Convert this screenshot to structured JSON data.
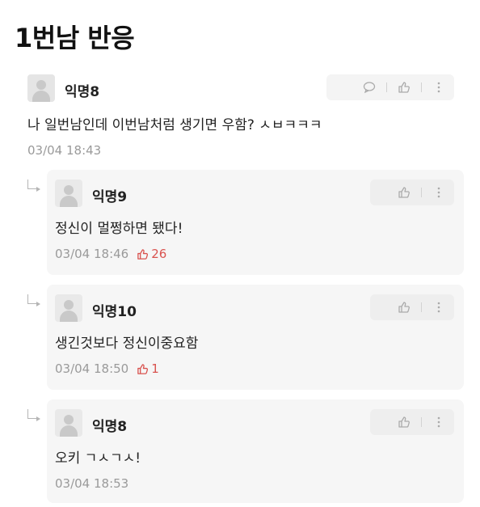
{
  "page": {
    "title": "1번남 반응"
  },
  "icons": {
    "comment": "comment-bubble-icon",
    "like": "thumbs-up-icon",
    "more": "more-vertical-icon",
    "reply": "reply-arrow-icon",
    "avatar": "default-avatar-icon"
  },
  "colors": {
    "like_red": "#d9534f",
    "meta_gray": "#9a9a9a",
    "card_bg": "#f6f6f6"
  },
  "top_comment": {
    "author": "익명8",
    "text": "나 일번남인데 이번남처럼 생기면 우함? ㅅㅂㅋㅋㅋ",
    "timestamp": "03/04 18:43"
  },
  "replies": [
    {
      "author": "익명9",
      "text": "정신이 멀쩡하면 됐다!",
      "timestamp": "03/04 18:46",
      "likes": "26"
    },
    {
      "author": "익명10",
      "text": "생긴것보다 정신이중요함",
      "timestamp": "03/04 18:50",
      "likes": "1"
    },
    {
      "author": "익명8",
      "text": "오키 ㄱㅅㄱㅅ!",
      "timestamp": "03/04 18:53"
    }
  ]
}
